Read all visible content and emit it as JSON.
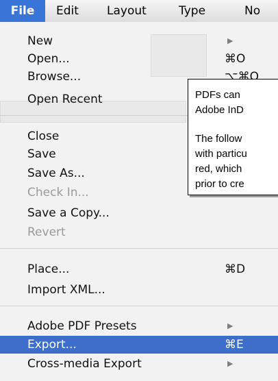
{
  "menubar": {
    "items": [
      {
        "label": "File",
        "active": true
      },
      {
        "label": "Edit"
      },
      {
        "label": "Layout"
      },
      {
        "label": "Type"
      },
      {
        "label": "No"
      }
    ]
  },
  "file_menu": {
    "new": {
      "label": "New",
      "submenu_icon": "triangle-right-icon"
    },
    "open": {
      "label": "Open...",
      "shortcut": "⌘O"
    },
    "browse": {
      "label": "Browse...",
      "shortcut": "⌥⌘O"
    },
    "open_recent": {
      "label": "Open Recent"
    },
    "close": {
      "label": "Close"
    },
    "save": {
      "label": "Save"
    },
    "save_as": {
      "label": "Save As..."
    },
    "check_in": {
      "label": "Check In...",
      "disabled": true
    },
    "save_copy": {
      "label": "Save a Copy..."
    },
    "revert": {
      "label": "Revert",
      "disabled": true
    },
    "place": {
      "label": "Place...",
      "shortcut": "⌘D"
    },
    "import_xml": {
      "label": "Import XML..."
    },
    "pdf_presets": {
      "label": "Adobe PDF Presets",
      "submenu_icon": "triangle-right-icon"
    },
    "export": {
      "label": "Export...",
      "shortcut": "⌘E",
      "highlighted": true
    },
    "cross_media": {
      "label": "Cross-media Export",
      "submenu_icon": "triangle-right-icon"
    }
  },
  "doc_box": {
    "line1": "PDFs  can",
    "line2": "Adobe InD",
    "line3": "The  follow",
    "line4": "with particu",
    "line5": "red,  which",
    "line6": "prior to cre"
  },
  "colors": {
    "highlight": "#3d6ec9",
    "menubar_active": "#3875d7"
  }
}
